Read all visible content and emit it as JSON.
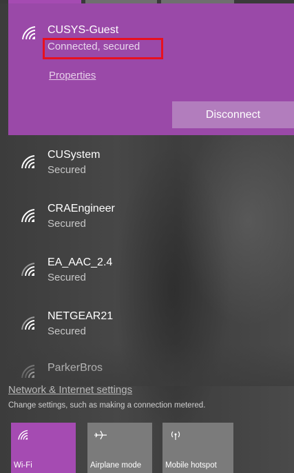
{
  "colors": {
    "accent": "#9a49a8",
    "highlight": "#e8101f",
    "disconnect_button": "#b27dbd",
    "tile_active": "#a54bb2",
    "tile_inactive": "#7b7b7b"
  },
  "connected_network": {
    "name": "CUSYS-Guest",
    "status": "Connected, secured",
    "properties_link": "Properties",
    "disconnect_label": "Disconnect",
    "icon": "wifi-icon"
  },
  "networks": [
    {
      "name": "CUSystem",
      "status": "Secured",
      "icon": "wifi-icon"
    },
    {
      "name": "CRAEngineer",
      "status": "Secured",
      "icon": "wifi-icon"
    },
    {
      "name": "EA_AAC_2.4",
      "status": "Secured",
      "icon": "wifi-icon"
    },
    {
      "name": "NETGEAR21",
      "status": "Secured",
      "icon": "wifi-icon"
    },
    {
      "name": "ParkerBros",
      "status": "",
      "icon": "wifi-icon"
    }
  ],
  "footer": {
    "settings_link": "Network & Internet settings",
    "settings_desc": "Change settings, such as making a connection metered."
  },
  "quick_actions": [
    {
      "label": "Wi-Fi",
      "icon": "wifi-icon",
      "active": true
    },
    {
      "label": "Airplane mode",
      "icon": "airplane-icon",
      "active": false
    },
    {
      "label": "Mobile hotspot",
      "icon": "hotspot-icon",
      "active": false
    }
  ]
}
